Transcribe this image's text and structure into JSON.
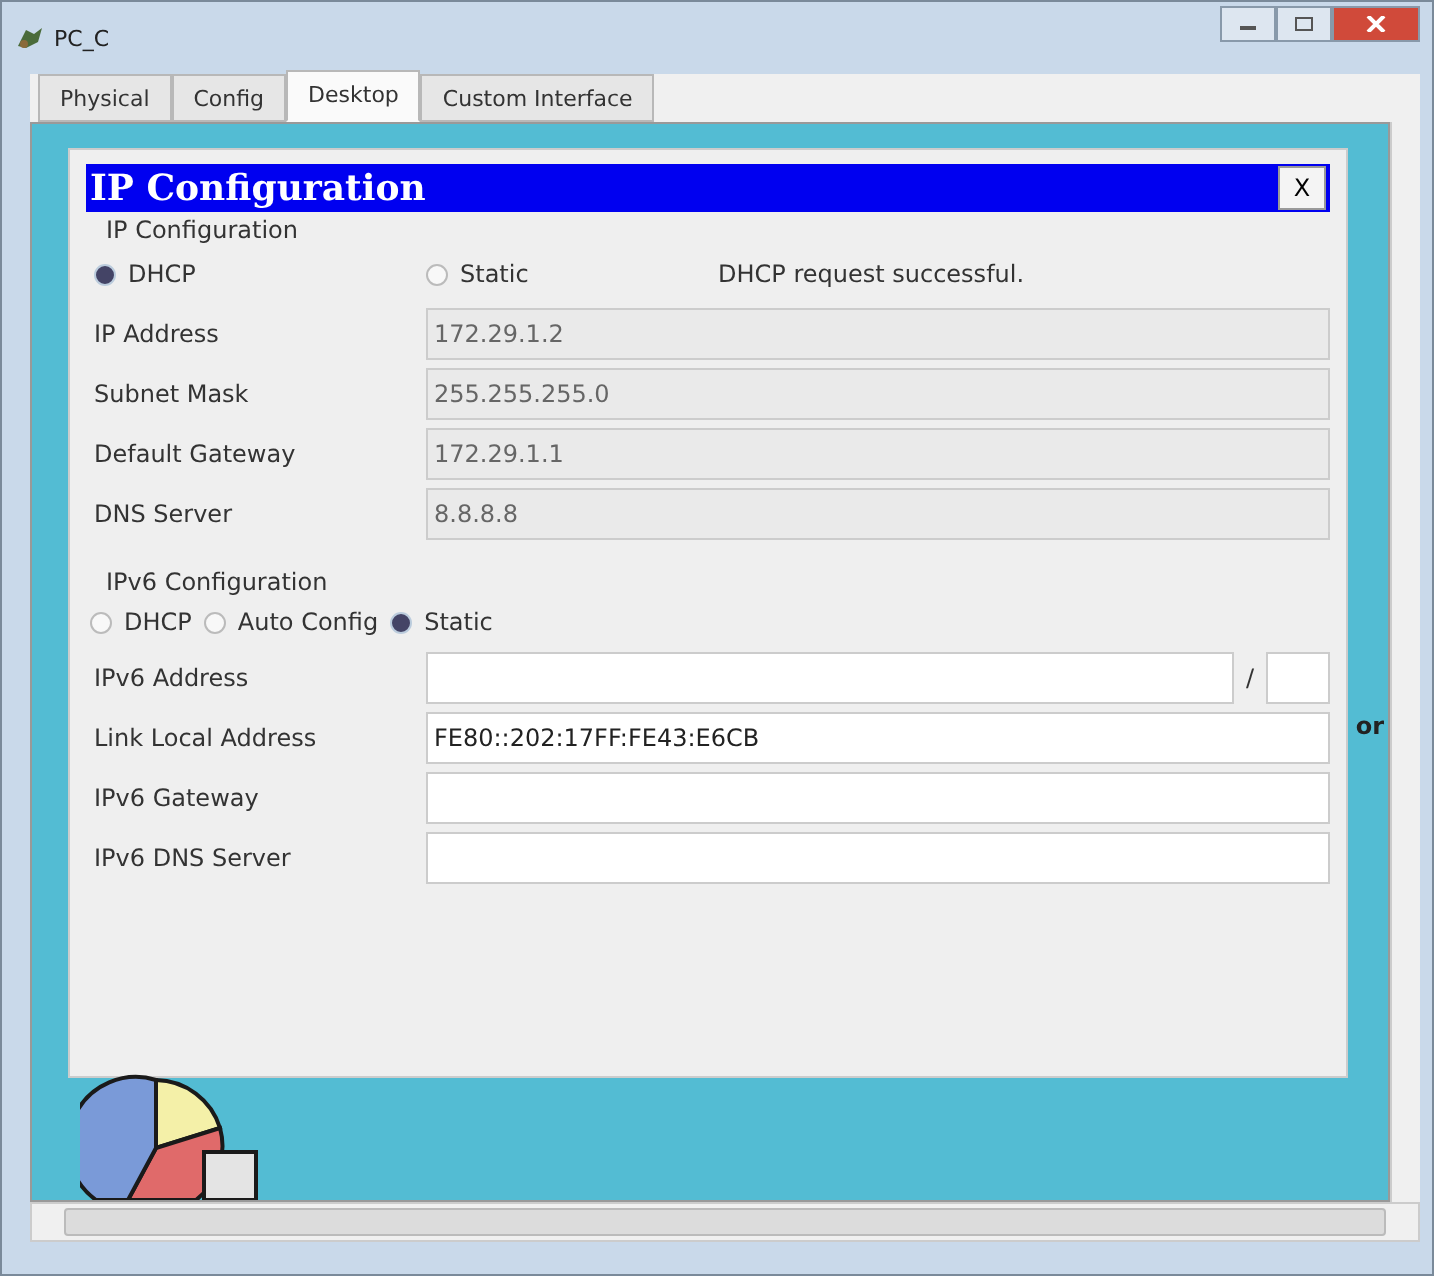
{
  "window": {
    "title": "PC_C"
  },
  "tabs": [
    {
      "label": "Physical",
      "selected": false
    },
    {
      "label": "Config",
      "selected": false
    },
    {
      "label": "Desktop",
      "selected": true
    },
    {
      "label": "Custom Interface",
      "selected": false
    }
  ],
  "dialog": {
    "title": "IP Configuration",
    "close": "X",
    "ipv4": {
      "heading": "IP Configuration",
      "modes": [
        {
          "label": "DHCP",
          "selected": true
        },
        {
          "label": "Static",
          "selected": false
        }
      ],
      "status": "DHCP request successful.",
      "fields": [
        {
          "label": "IP Address",
          "value": "172.29.1.2",
          "disabled": true
        },
        {
          "label": "Subnet Mask",
          "value": "255.255.255.0",
          "disabled": true
        },
        {
          "label": "Default Gateway",
          "value": "172.29.1.1",
          "disabled": true
        },
        {
          "label": "DNS Server",
          "value": "8.8.8.8",
          "disabled": true
        }
      ]
    },
    "ipv6": {
      "heading": "IPv6 Configuration",
      "modes": [
        {
          "label": "DHCP",
          "selected": false
        },
        {
          "label": "Auto Config",
          "selected": false
        },
        {
          "label": "Static",
          "selected": true
        }
      ],
      "fields": [
        {
          "label": "IPv6 Address",
          "kind": "prefix",
          "separator": "/"
        },
        {
          "label": "Link Local Address",
          "value": "FE80::202:17FF:FE43:E6CB",
          "kind": "plain"
        },
        {
          "label": "IPv6 Gateway",
          "kind": "plain"
        },
        {
          "label": "IPv6 DNS Server",
          "kind": "plain"
        }
      ]
    }
  },
  "background_text": "or"
}
